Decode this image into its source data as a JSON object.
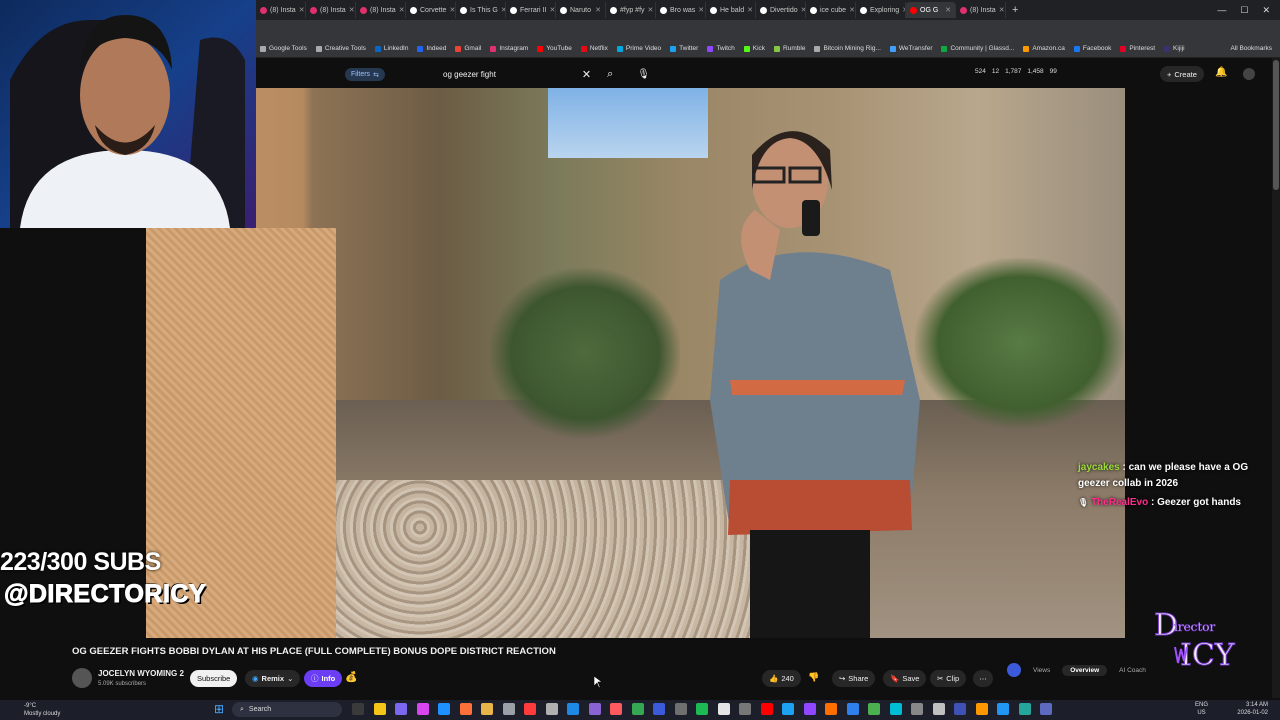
{
  "browser": {
    "tabs": [
      {
        "label": "(8) Insta",
        "color": "#e1306c"
      },
      {
        "label": "(8) Insta",
        "color": "#e1306c"
      },
      {
        "label": "(8) Insta",
        "color": "#e1306c"
      },
      {
        "label": "Corvette",
        "color": "#ffffff"
      },
      {
        "label": "Is This G",
        "color": "#ffffff"
      },
      {
        "label": "Ferrari II",
        "color": "#ffffff"
      },
      {
        "label": "Naruto",
        "color": "#ffffff"
      },
      {
        "label": "#fyp #fy",
        "color": "#ffffff"
      },
      {
        "label": "Bro was",
        "color": "#ffffff"
      },
      {
        "label": "He bald",
        "color": "#ffffff"
      },
      {
        "label": "Divertido",
        "color": "#ffffff"
      },
      {
        "label": "ice cube",
        "color": "#ffffff"
      },
      {
        "label": "Exploring",
        "color": "#ffffff"
      },
      {
        "label": "OG G",
        "color": "#ff0000",
        "active": true
      },
      {
        "label": "(8) Insta",
        "color": "#e1306c"
      }
    ],
    "bookmarks": [
      {
        "label": "Google Tools",
        "color": "#aaaaaa"
      },
      {
        "label": "Creative Tools",
        "color": "#aaaaaa"
      },
      {
        "label": "LinkedIn",
        "color": "#0a66c2"
      },
      {
        "label": "Indeed",
        "color": "#2164f3"
      },
      {
        "label": "Gmail",
        "color": "#ea4335"
      },
      {
        "label": "Instagram",
        "color": "#e1306c"
      },
      {
        "label": "YouTube",
        "color": "#ff0000"
      },
      {
        "label": "Netflix",
        "color": "#e50914"
      },
      {
        "label": "Prime Video",
        "color": "#00a8e1"
      },
      {
        "label": "Twitter",
        "color": "#1da1f2"
      },
      {
        "label": "Twitch",
        "color": "#9146ff"
      },
      {
        "label": "Kick",
        "color": "#53fc18"
      },
      {
        "label": "Rumble",
        "color": "#85c742"
      },
      {
        "label": "Bitcoin Mining Rig...",
        "color": "#aaaaaa"
      },
      {
        "label": "WeTransfer",
        "color": "#409fff"
      },
      {
        "label": "Community | Glassd...",
        "color": "#0caa41"
      },
      {
        "label": "Amazon.ca",
        "color": "#ff9900"
      },
      {
        "label": "Facebook",
        "color": "#1877f2"
      },
      {
        "label": "Pinterest",
        "color": "#e60023"
      },
      {
        "label": "Kijiji",
        "color": "#373373"
      }
    ],
    "all_bookmarks": "All Bookmarks"
  },
  "youtube": {
    "filters_label": "Filters",
    "search_value": "og geezer fight",
    "stats": [
      "524",
      "12",
      "1,787",
      "1,458",
      "99"
    ],
    "create_label": "Create",
    "video_title": "OG GEEZER FIGHTS BOBBI DYLAN AT HIS PLACE (FULL COMPLETE) BONUS DOPE DISTRICT REACTION",
    "channel_name": "JOCELYN WYOMING 2",
    "channel_subs": "5.09K subscribers",
    "subscribe_label": "Subscribe",
    "remix_label": "Remix",
    "info_label": "Info",
    "like_count": "240",
    "share_label": "Share",
    "save_label": "Save",
    "clip_label": "Clip",
    "analytics_tabs": [
      "Views",
      "Overview",
      "AI Coach"
    ]
  },
  "stream_overlay": {
    "subs_goal": "223/300 SUBS",
    "handle": "@DIRECTORICY",
    "chat": [
      {
        "user": "jaycakes",
        "message": "can we please have a OG geezer collab in 2026"
      },
      {
        "user": "TheRealEvo",
        "message": "Geezer got hands"
      }
    ],
    "logo_text": "Director Icy"
  },
  "taskbar": {
    "weather_temp": "-9°C",
    "weather_desc": "Mostly cloudy",
    "search_placeholder": "Search",
    "lang_top": "ENG",
    "lang_bottom": "US",
    "time": "3:14 AM",
    "date": "2026-01-02"
  }
}
